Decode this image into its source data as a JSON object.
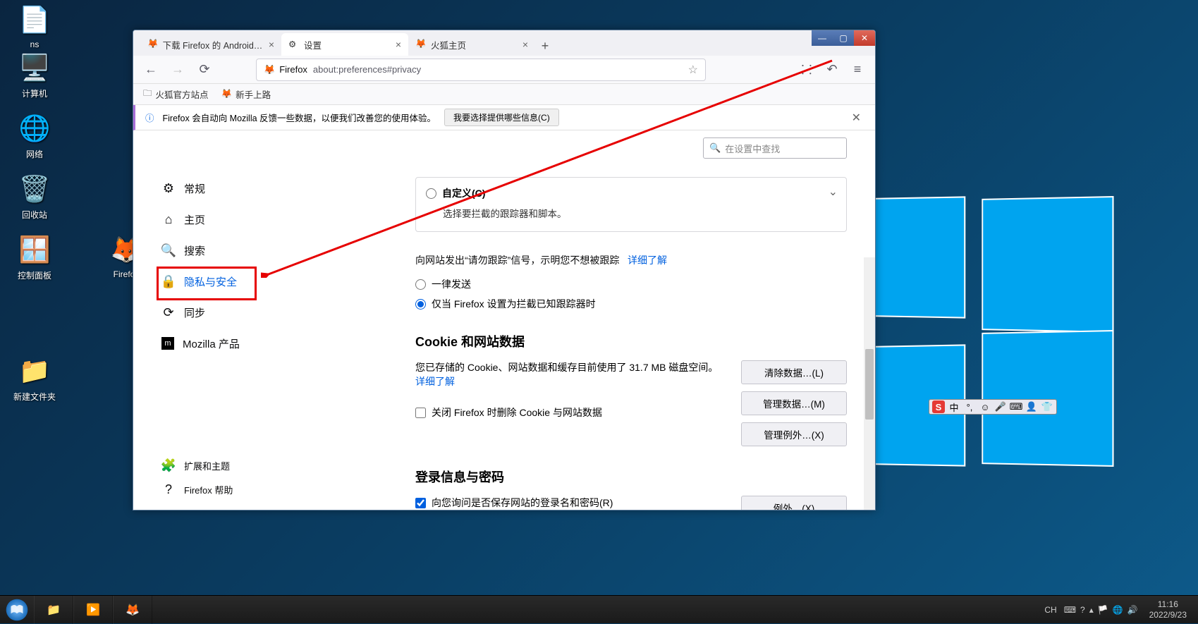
{
  "desktop": {
    "icons": [
      {
        "label": "ns"
      },
      {
        "label": "计算机"
      },
      {
        "label": "网络"
      },
      {
        "label": "回收站"
      },
      {
        "label": "控制面板"
      },
      {
        "label": "Firefox"
      },
      {
        "label": "新建文件夹"
      }
    ]
  },
  "window_controls": {
    "min": "—",
    "max": "▢",
    "close": "✕"
  },
  "tabs": [
    {
      "title": "下载 Firefox 的 Android 与 iO",
      "active": false
    },
    {
      "title": "设置",
      "active": true
    },
    {
      "title": "火狐主页",
      "active": false
    }
  ],
  "toolbar": {
    "identity_label": "Firefox",
    "url": "about:preferences#privacy"
  },
  "bookmarks": [
    {
      "label": "火狐官方站点"
    },
    {
      "label": "新手上路"
    }
  ],
  "banner": {
    "text": "Firefox 会自动向 Mozilla 反馈一些数据，以便我们改善您的使用体验。",
    "button": "我要选择提供哪些信息(C)"
  },
  "search": {
    "placeholder": "在设置中查找"
  },
  "sidebar": {
    "items": [
      {
        "icon": "gear",
        "label": "常规"
      },
      {
        "icon": "home",
        "label": "主页"
      },
      {
        "icon": "search",
        "label": "搜索"
      },
      {
        "icon": "lock",
        "label": "隐私与安全"
      },
      {
        "icon": "sync",
        "label": "同步"
      },
      {
        "icon": "mozilla",
        "label": "Mozilla 产品"
      }
    ],
    "bottom": [
      {
        "icon": "puzzle",
        "label": "扩展和主题"
      },
      {
        "icon": "help",
        "label": "Firefox 帮助"
      }
    ]
  },
  "content": {
    "custom": {
      "label": "自定义(C)",
      "desc": "选择要拦截的跟踪器和脚本。"
    },
    "dnt": {
      "intro": "向网站发出“请勿跟踪”信号，示明您不想被跟踪",
      "learn_more": "详细了解",
      "opt_always": "一律发送",
      "opt_known": "仅当 Firefox 设置为拦截已知跟踪器时"
    },
    "cookies": {
      "title": "Cookie 和网站数据",
      "stored": "您已存储的 Cookie、网站数据和缓存目前使用了 31.7 MB 磁盘空间。",
      "learn_more": "详细了解",
      "delete_on_close": "关闭 Firefox 时删除 Cookie 与网站数据",
      "btn_clear": "清除数据…(L)",
      "btn_manage": "管理数据…(M)",
      "btn_exceptions": "管理例外…(X)"
    },
    "logins": {
      "title": "登录信息与密码",
      "ask_save": "向您询问是否保存网站的登录名和密码(R)",
      "btn_exceptions": "例外…(X)"
    }
  },
  "ime": {
    "lang": "中",
    "items": [
      "S",
      "中",
      "°,",
      "☺",
      "🎤",
      "⌨",
      "👤",
      "👕"
    ]
  },
  "tray": {
    "lang": "CH",
    "time": "11:16",
    "date": "2022/9/23"
  }
}
